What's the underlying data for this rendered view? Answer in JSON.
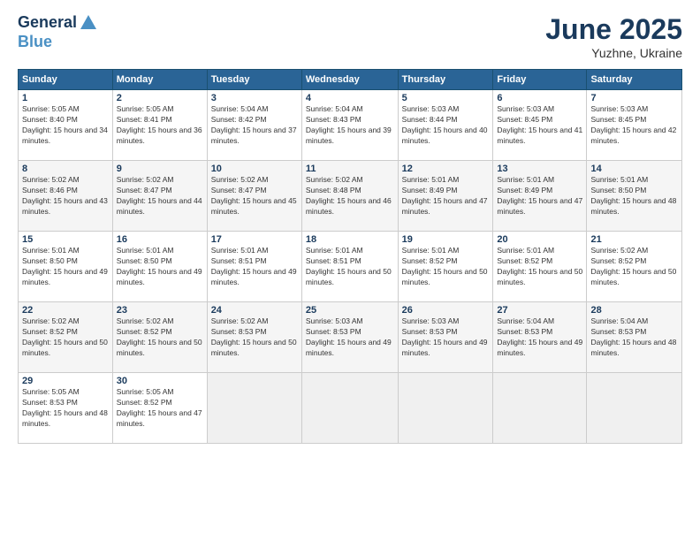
{
  "header": {
    "logo_line1": "General",
    "logo_line2": "Blue",
    "month": "June 2025",
    "location": "Yuzhne, Ukraine"
  },
  "weekdays": [
    "Sunday",
    "Monday",
    "Tuesday",
    "Wednesday",
    "Thursday",
    "Friday",
    "Saturday"
  ],
  "weeks": [
    [
      {
        "day": "1",
        "sunrise": "Sunrise: 5:05 AM",
        "sunset": "Sunset: 8:40 PM",
        "daylight": "Daylight: 15 hours and 34 minutes."
      },
      {
        "day": "2",
        "sunrise": "Sunrise: 5:05 AM",
        "sunset": "Sunset: 8:41 PM",
        "daylight": "Daylight: 15 hours and 36 minutes."
      },
      {
        "day": "3",
        "sunrise": "Sunrise: 5:04 AM",
        "sunset": "Sunset: 8:42 PM",
        "daylight": "Daylight: 15 hours and 37 minutes."
      },
      {
        "day": "4",
        "sunrise": "Sunrise: 5:04 AM",
        "sunset": "Sunset: 8:43 PM",
        "daylight": "Daylight: 15 hours and 39 minutes."
      },
      {
        "day": "5",
        "sunrise": "Sunrise: 5:03 AM",
        "sunset": "Sunset: 8:44 PM",
        "daylight": "Daylight: 15 hours and 40 minutes."
      },
      {
        "day": "6",
        "sunrise": "Sunrise: 5:03 AM",
        "sunset": "Sunset: 8:45 PM",
        "daylight": "Daylight: 15 hours and 41 minutes."
      },
      {
        "day": "7",
        "sunrise": "Sunrise: 5:03 AM",
        "sunset": "Sunset: 8:45 PM",
        "daylight": "Daylight: 15 hours and 42 minutes."
      }
    ],
    [
      {
        "day": "8",
        "sunrise": "Sunrise: 5:02 AM",
        "sunset": "Sunset: 8:46 PM",
        "daylight": "Daylight: 15 hours and 43 minutes."
      },
      {
        "day": "9",
        "sunrise": "Sunrise: 5:02 AM",
        "sunset": "Sunset: 8:47 PM",
        "daylight": "Daylight: 15 hours and 44 minutes."
      },
      {
        "day": "10",
        "sunrise": "Sunrise: 5:02 AM",
        "sunset": "Sunset: 8:47 PM",
        "daylight": "Daylight: 15 hours and 45 minutes."
      },
      {
        "day": "11",
        "sunrise": "Sunrise: 5:02 AM",
        "sunset": "Sunset: 8:48 PM",
        "daylight": "Daylight: 15 hours and 46 minutes."
      },
      {
        "day": "12",
        "sunrise": "Sunrise: 5:01 AM",
        "sunset": "Sunset: 8:49 PM",
        "daylight": "Daylight: 15 hours and 47 minutes."
      },
      {
        "day": "13",
        "sunrise": "Sunrise: 5:01 AM",
        "sunset": "Sunset: 8:49 PM",
        "daylight": "Daylight: 15 hours and 47 minutes."
      },
      {
        "day": "14",
        "sunrise": "Sunrise: 5:01 AM",
        "sunset": "Sunset: 8:50 PM",
        "daylight": "Daylight: 15 hours and 48 minutes."
      }
    ],
    [
      {
        "day": "15",
        "sunrise": "Sunrise: 5:01 AM",
        "sunset": "Sunset: 8:50 PM",
        "daylight": "Daylight: 15 hours and 49 minutes."
      },
      {
        "day": "16",
        "sunrise": "Sunrise: 5:01 AM",
        "sunset": "Sunset: 8:50 PM",
        "daylight": "Daylight: 15 hours and 49 minutes."
      },
      {
        "day": "17",
        "sunrise": "Sunrise: 5:01 AM",
        "sunset": "Sunset: 8:51 PM",
        "daylight": "Daylight: 15 hours and 49 minutes."
      },
      {
        "day": "18",
        "sunrise": "Sunrise: 5:01 AM",
        "sunset": "Sunset: 8:51 PM",
        "daylight": "Daylight: 15 hours and 50 minutes."
      },
      {
        "day": "19",
        "sunrise": "Sunrise: 5:01 AM",
        "sunset": "Sunset: 8:52 PM",
        "daylight": "Daylight: 15 hours and 50 minutes."
      },
      {
        "day": "20",
        "sunrise": "Sunrise: 5:01 AM",
        "sunset": "Sunset: 8:52 PM",
        "daylight": "Daylight: 15 hours and 50 minutes."
      },
      {
        "day": "21",
        "sunrise": "Sunrise: 5:02 AM",
        "sunset": "Sunset: 8:52 PM",
        "daylight": "Daylight: 15 hours and 50 minutes."
      }
    ],
    [
      {
        "day": "22",
        "sunrise": "Sunrise: 5:02 AM",
        "sunset": "Sunset: 8:52 PM",
        "daylight": "Daylight: 15 hours and 50 minutes."
      },
      {
        "day": "23",
        "sunrise": "Sunrise: 5:02 AM",
        "sunset": "Sunset: 8:52 PM",
        "daylight": "Daylight: 15 hours and 50 minutes."
      },
      {
        "day": "24",
        "sunrise": "Sunrise: 5:02 AM",
        "sunset": "Sunset: 8:53 PM",
        "daylight": "Daylight: 15 hours and 50 minutes."
      },
      {
        "day": "25",
        "sunrise": "Sunrise: 5:03 AM",
        "sunset": "Sunset: 8:53 PM",
        "daylight": "Daylight: 15 hours and 49 minutes."
      },
      {
        "day": "26",
        "sunrise": "Sunrise: 5:03 AM",
        "sunset": "Sunset: 8:53 PM",
        "daylight": "Daylight: 15 hours and 49 minutes."
      },
      {
        "day": "27",
        "sunrise": "Sunrise: 5:04 AM",
        "sunset": "Sunset: 8:53 PM",
        "daylight": "Daylight: 15 hours and 49 minutes."
      },
      {
        "day": "28",
        "sunrise": "Sunrise: 5:04 AM",
        "sunset": "Sunset: 8:53 PM",
        "daylight": "Daylight: 15 hours and 48 minutes."
      }
    ],
    [
      {
        "day": "29",
        "sunrise": "Sunrise: 5:05 AM",
        "sunset": "Sunset: 8:53 PM",
        "daylight": "Daylight: 15 hours and 48 minutes."
      },
      {
        "day": "30",
        "sunrise": "Sunrise: 5:05 AM",
        "sunset": "Sunset: 8:52 PM",
        "daylight": "Daylight: 15 hours and 47 minutes."
      },
      null,
      null,
      null,
      null,
      null
    ]
  ]
}
